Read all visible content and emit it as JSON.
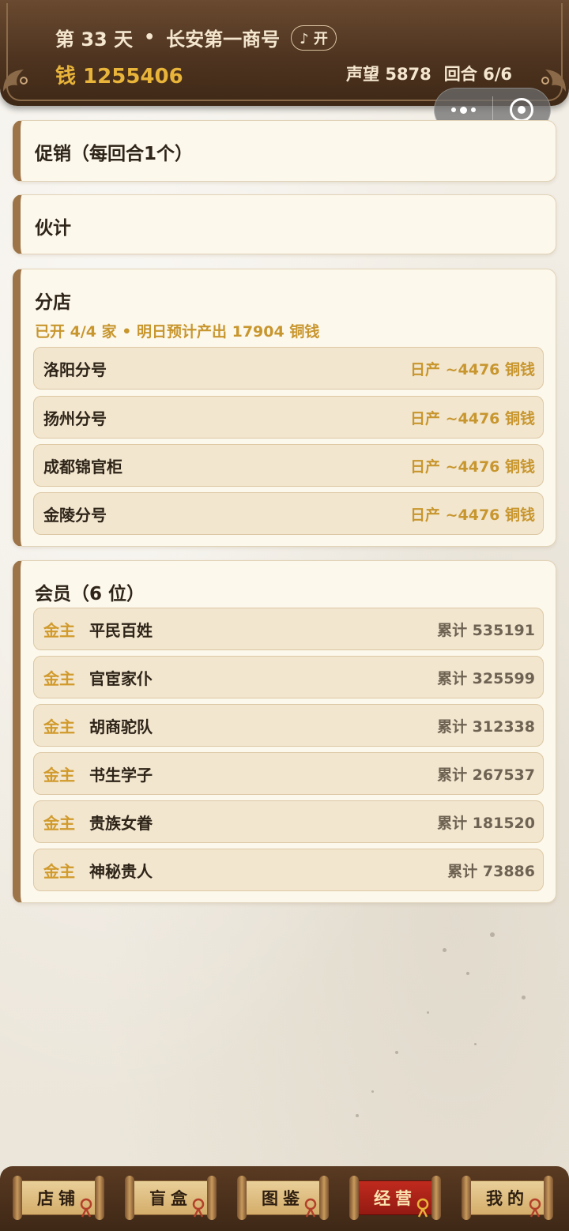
{
  "header": {
    "day_label": "第 33 天",
    "separator": "•",
    "shop_name": "长安第一商号",
    "music_toggle": "♪ 开",
    "money": "钱 1255406",
    "reputation": "声望 5878",
    "round": "回合 6/6"
  },
  "promotion": {
    "title": "促销（每回合1个）"
  },
  "staff": {
    "title": "伙计"
  },
  "branches": {
    "title": "分店",
    "summary": "已开 4/4 家 • 明日预计产出 17904 铜钱",
    "items": [
      {
        "name": "洛阳分号",
        "output": "日产 ~4476 铜钱"
      },
      {
        "name": "扬州分号",
        "output": "日产 ~4476 铜钱"
      },
      {
        "name": "成都锦官柜",
        "output": "日产 ~4476 铜钱"
      },
      {
        "name": "金陵分号",
        "output": "日产 ~4476 铜钱"
      }
    ]
  },
  "members": {
    "title": "会员（6 位）",
    "items": [
      {
        "tier": "金主",
        "name": "平民百姓",
        "total": "累计 535191"
      },
      {
        "tier": "金主",
        "name": "官宦家仆",
        "total": "累计 325599"
      },
      {
        "tier": "金主",
        "name": "胡商驼队",
        "total": "累计 312338"
      },
      {
        "tier": "金主",
        "name": "书生学子",
        "total": "累计 267537"
      },
      {
        "tier": "金主",
        "name": "贵族女眷",
        "total": "累计 181520"
      },
      {
        "tier": "金主",
        "name": "神秘贵人",
        "total": "累计 73886"
      }
    ]
  },
  "nav": {
    "tabs": [
      {
        "label": "店铺",
        "active": false
      },
      {
        "label": "盲盒",
        "active": false
      },
      {
        "label": "图鉴",
        "active": false
      },
      {
        "label": "经营",
        "active": true
      },
      {
        "label": "我的",
        "active": false
      }
    ]
  },
  "colors": {
    "accent_gold": "#c8962e",
    "money_gold": "#e9b43a",
    "header_brown": "#4e3420",
    "panel_border": "#9c7448",
    "active_tab_red": "#c02a1e"
  },
  "icons": [
    "more-dots-icon",
    "target-circle-icon",
    "music-note-icon",
    "lucky-knot-icon"
  ]
}
